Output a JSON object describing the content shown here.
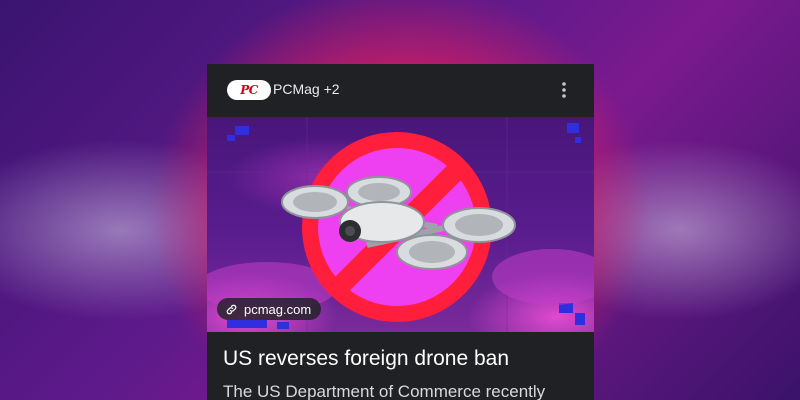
{
  "card": {
    "logo_text": "PC",
    "source_label": "PCMag +2",
    "more_icon": "more-vert-icon",
    "thumbnail": {
      "link_icon": "link-icon",
      "source_chip_label": "pcmag.com",
      "prohibition_color": "#ff1e3c",
      "circle_fill": "#ee40f0"
    },
    "headline": "US reverses foreign drone ban",
    "snippet": "The US Department of Commerce recently"
  },
  "colors": {
    "card_background": "#202124",
    "text_primary": "#ffffff",
    "text_secondary": "#d7d9dc",
    "logo_red": "#d0021b"
  }
}
